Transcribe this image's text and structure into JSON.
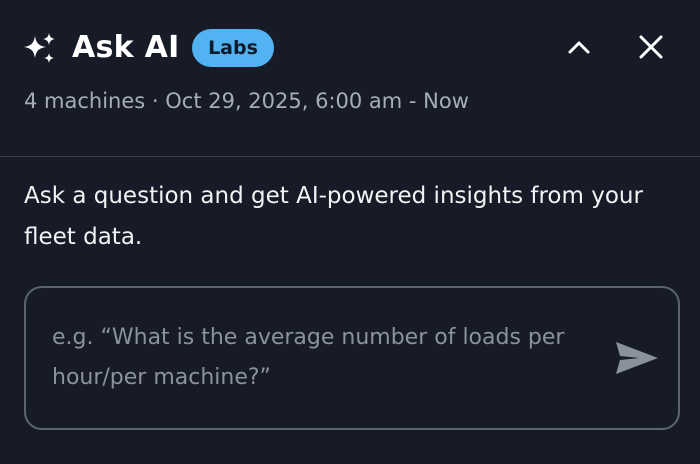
{
  "header": {
    "icon": "sparkle-icon",
    "title": "Ask AI",
    "badge": "Labs",
    "badge_color": "#52b3f3",
    "collapse_icon": "chevron-up-icon",
    "close_icon": "close-icon",
    "subtitle": "4 machines · Oct 29, 2025, 6:00 am - Now"
  },
  "main": {
    "description": "Ask a question and get AI-powered insights from your fleet data.",
    "input": {
      "value": "",
      "placeholder": "e.g. “What is the average number of loads per hour/per machine?”",
      "send_icon": "send-icon"
    }
  },
  "colors": {
    "background": "#161b27",
    "text": "#f2f3f5",
    "muted_text": "#a7adb8",
    "border": "#5d6470"
  }
}
